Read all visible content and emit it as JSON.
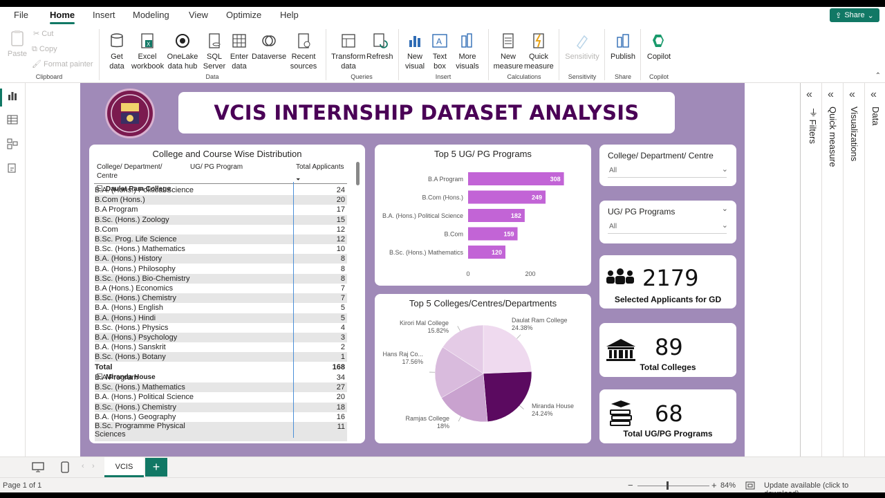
{
  "menu": {
    "tabs": [
      "File",
      "Home",
      "Insert",
      "Modeling",
      "View",
      "Optimize",
      "Help"
    ],
    "active": "Home",
    "share_label": "Share"
  },
  "ribbon": {
    "clipboard": {
      "paste": "Paste",
      "cut": "Cut",
      "copy": "Copy",
      "format_painter": "Format painter",
      "group": "Clipboard"
    },
    "data": {
      "get_data": "Get data",
      "excel": "Excel workbook",
      "onelake": "OneLake data hub",
      "sql": "SQL Server",
      "enter": "Enter data",
      "dataverse": "Dataverse",
      "recent": "Recent sources",
      "group": "Data"
    },
    "queries": {
      "transform": "Transform data",
      "refresh": "Refresh",
      "group": "Queries"
    },
    "insert": {
      "new_visual": "New visual",
      "text_box": "Text box",
      "more_visuals": "More visuals",
      "group": "Insert"
    },
    "calculations": {
      "new_measure": "New measure",
      "quick_measure": "Quick measure",
      "group": "Calculations"
    },
    "sensitivity": {
      "label": "Sensitivity",
      "group": "Sensitivity"
    },
    "share": {
      "publish": "Publish",
      "group": "Share"
    },
    "copilot": {
      "label": "Copilot",
      "group": "Copilot"
    }
  },
  "report": {
    "title": "VCIS INTERNSHIP DATASET ANALYSIS",
    "matrix": {
      "title": "College and Course Wise Distribution",
      "col1": "College/ Department/ Centre",
      "col2": "UG/ PG Program",
      "col3": "Total Applicants",
      "groups": [
        {
          "college": "Daulat Ram College",
          "rows": [
            [
              "B.A. (Hons.) Political Science",
              "24"
            ],
            [
              "B.Com (Hons.)",
              "20"
            ],
            [
              "B.A Program",
              "17"
            ],
            [
              "B.Sc. (Hons.) Zoology",
              "15"
            ],
            [
              "B.Com",
              "12"
            ],
            [
              "B.Sc. Prog. Life Science",
              "12"
            ],
            [
              "B.Sc. (Hons.) Mathematics",
              "10"
            ],
            [
              "B.A. (Hons.) History",
              "8"
            ],
            [
              "B.A. (Hons.) Philosophy",
              "8"
            ],
            [
              "B.Sc. (Hons.) Bio-Chemistry",
              "8"
            ],
            [
              "B.A (Hons.) Economics",
              "7"
            ],
            [
              "B.Sc. (Hons.) Chemistry",
              "7"
            ],
            [
              "B.A. (Hons.) English",
              "5"
            ],
            [
              "B.A. (Hons.) Hindi",
              "5"
            ],
            [
              "B.Sc. (Hons.) Physics",
              "4"
            ],
            [
              "B.A. (Hons.) Psychology",
              "3"
            ],
            [
              "B.A. (Hons.) Sanskrit",
              "2"
            ],
            [
              "B.Sc. (Hons.) Botany",
              "1"
            ]
          ],
          "total_label": "Total",
          "total": "168"
        },
        {
          "college": "Miranda House",
          "rows": [
            [
              "B.A Program",
              "34"
            ],
            [
              "B.Sc. (Hons.) Mathematics",
              "27"
            ],
            [
              "B.A. (Hons.) Political Science",
              "20"
            ],
            [
              "B.Sc. (Hons.) Chemistry",
              "18"
            ],
            [
              "B.A. (Hons.) Geography",
              "16"
            ],
            [
              "B.Sc. Programme Physical Sciences",
              "11"
            ]
          ]
        }
      ]
    },
    "slicers": [
      {
        "label": "College/ Department/ Centre",
        "value": "All"
      },
      {
        "label": "UG/ PG Programs",
        "value": "All"
      }
    ],
    "kpis": [
      {
        "value": "2179",
        "label": "Selected Applicants for GD",
        "icon": "people-icon"
      },
      {
        "value": "89",
        "label": "Total Colleges",
        "icon": "building-icon"
      },
      {
        "value": "68",
        "label": "Total UG/PG Programs",
        "icon": "books-icon"
      }
    ]
  },
  "chart_data": [
    {
      "type": "bar",
      "title": "Top 5 UG/ PG Programs",
      "categories": [
        "B.A Program",
        "B.Com (Hons.)",
        "B.A. (Hons.) Political Science",
        "B.Com",
        "B.Sc. (Hons.) Mathematics"
      ],
      "values": [
        308,
        249,
        182,
        159,
        120
      ],
      "xticks": [
        0,
        200
      ],
      "color": "#c264d6"
    },
    {
      "type": "pie",
      "title": "Top 5 Colleges/Centres/Departments",
      "labels": [
        "Daulat Ram College",
        "Miranda House",
        "Ramjas College",
        "Hans Raj Co...",
        "Kirori Mal College"
      ],
      "values": [
        24.38,
        24.24,
        18,
        17.56,
        15.82
      ],
      "value_labels": [
        "24.38%",
        "24.24%",
        "18%",
        "17.56%",
        "15.82%"
      ],
      "colors": [
        "#efdaef",
        "#5b0a60",
        "#c9a2cf",
        "#d9bbdd",
        "#e4cbe6"
      ]
    }
  ],
  "panes": [
    "Filters",
    "Quick measure",
    "Visualizations",
    "Data"
  ],
  "tabs": {
    "page": "VCIS",
    "add": "+"
  },
  "status": {
    "page": "Page 1 of 1",
    "zoom": "84%",
    "update": "Update available (click to download)"
  }
}
